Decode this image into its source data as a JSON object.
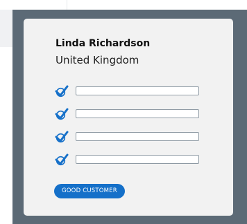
{
  "customer": {
    "name": "Linda Richardson",
    "country": "United Kingdom"
  },
  "checklist": [
    {
      "checked": true,
      "value": ""
    },
    {
      "checked": true,
      "value": ""
    },
    {
      "checked": true,
      "value": ""
    },
    {
      "checked": true,
      "value": ""
    }
  ],
  "badge": {
    "label": "GOOD CUSTOMER"
  },
  "colors": {
    "frame": "#5c6a76",
    "card": "#f2f2f2",
    "accent": "#1570c9",
    "check": "#1570c9"
  },
  "icons": {
    "check": "check-icon"
  }
}
